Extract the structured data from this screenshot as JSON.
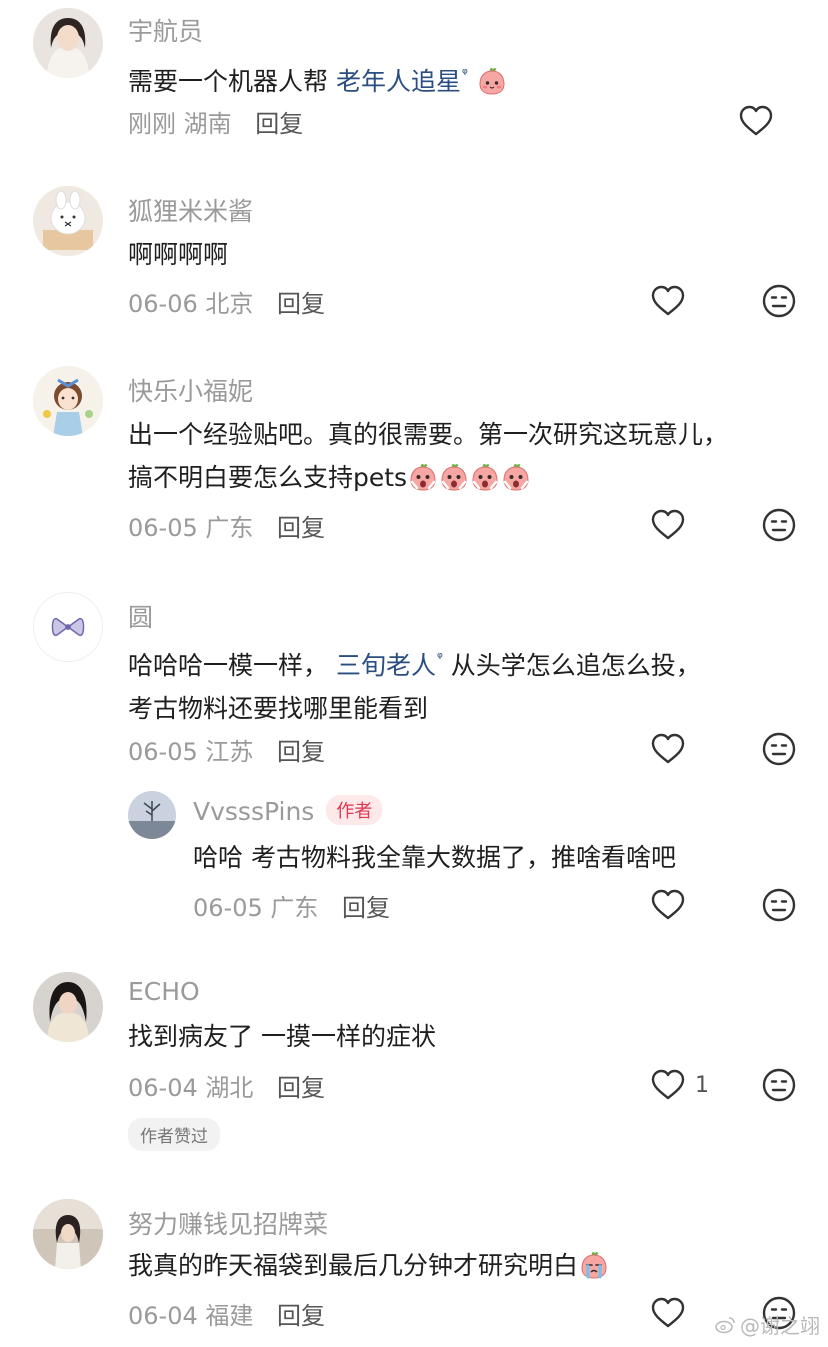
{
  "colors": {
    "link": "#2b4e80",
    "muted": "#9a9a9a",
    "author_badge": "#e4364f"
  },
  "comments": [
    {
      "name": "宇航员",
      "text_plain": "需要一个机器人帮 ",
      "link": "老年人追星",
      "emoji": "pink-blob-emoji",
      "date": "刚刚",
      "location": "湖南",
      "reply_label": "回复"
    },
    {
      "name": "狐狸米米酱",
      "text": "啊啊啊啊",
      "date": "06-06",
      "location": "北京",
      "reply_label": "回复"
    },
    {
      "name": "快乐小福妮",
      "text_line1": "出一个经验贴吧。真的很需要。第一次研究这玩意儿，",
      "text_line2": "搞不明白要怎么支持pets",
      "emojis": [
        "shocked-blob-emoji",
        "shocked-blob-emoji",
        "shocked-blob-emoji",
        "shocked-blob-emoji"
      ],
      "date": "06-05",
      "location": "广东",
      "reply_label": "回复"
    },
    {
      "name": "圆",
      "text_before": "哈哈哈一模一样，",
      "link": "三旬老人",
      "text_after": "从头学怎么追怎么投，",
      "text_line2": "考古物料还要找哪里能看到",
      "date": "06-05",
      "location": "江苏",
      "reply_label": "回复",
      "reply": {
        "name": "VvsssPins",
        "badge": "作者",
        "text": "哈哈 考古物料我全靠大数据了，推啥看啥吧",
        "date": "06-05",
        "location": "广东",
        "reply_label": "回复"
      }
    },
    {
      "name": "ECHO",
      "text": "找到病友了 一摸一样的症状",
      "date": "06-04",
      "location": "湖北",
      "reply_label": "回复",
      "like_count": "1",
      "liked_tag": "作者赞过"
    },
    {
      "name": "努力赚钱见招牌菜",
      "text": "我真的昨天福袋到最后几分钟才研究明白",
      "emoji": "crying-blob-emoji",
      "date": "06-04",
      "location": "福建",
      "reply_label": "回复"
    }
  ],
  "watermark": "@谢之翊"
}
